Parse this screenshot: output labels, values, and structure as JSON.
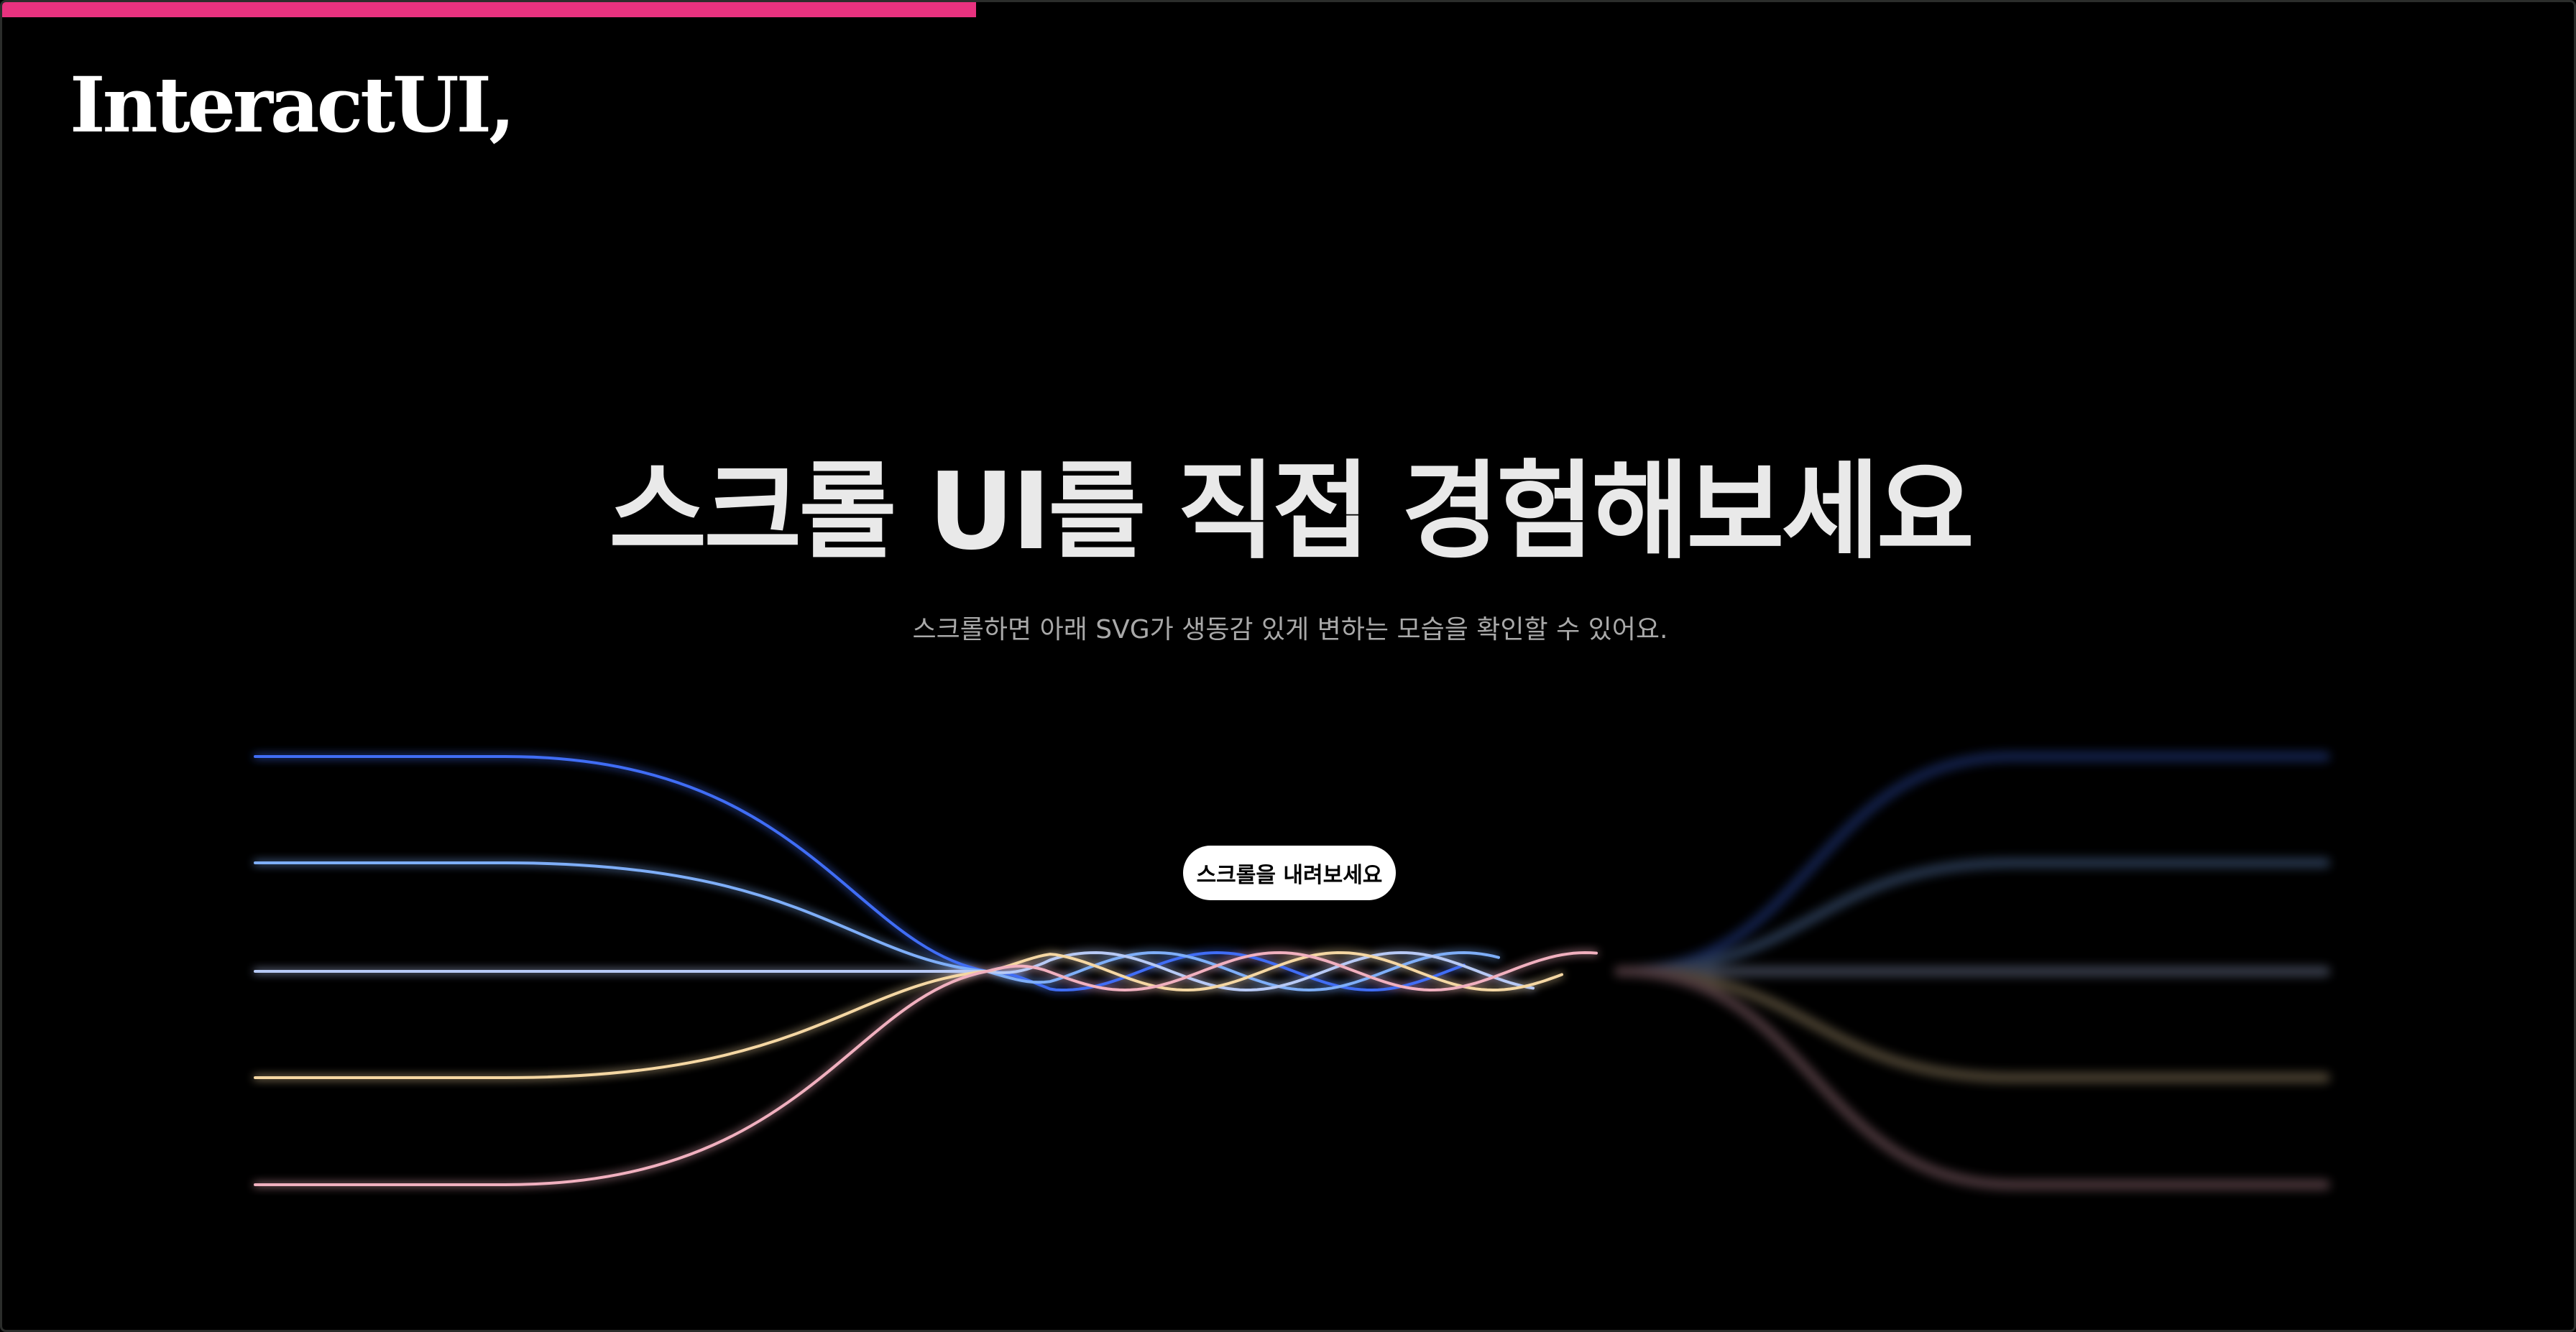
{
  "header": {
    "logo_text": "InteractUI,"
  },
  "scroll_progress": {
    "value": 0.378,
    "color": "#e8327f"
  },
  "hero": {
    "title": "스크롤 UI를 직접 경험해보세요",
    "subtitle": "스크롤하면 아래 SVG가 생동감 있게 변하는 모습을 확인할 수 있어요."
  },
  "cta": {
    "label": "스크롤을 내려보세요"
  },
  "waves": {
    "colors": [
      "#3f6df5",
      "#7eaef8",
      "#b7c9f5",
      "#f5d7a3",
      "#f1b0bf"
    ]
  }
}
